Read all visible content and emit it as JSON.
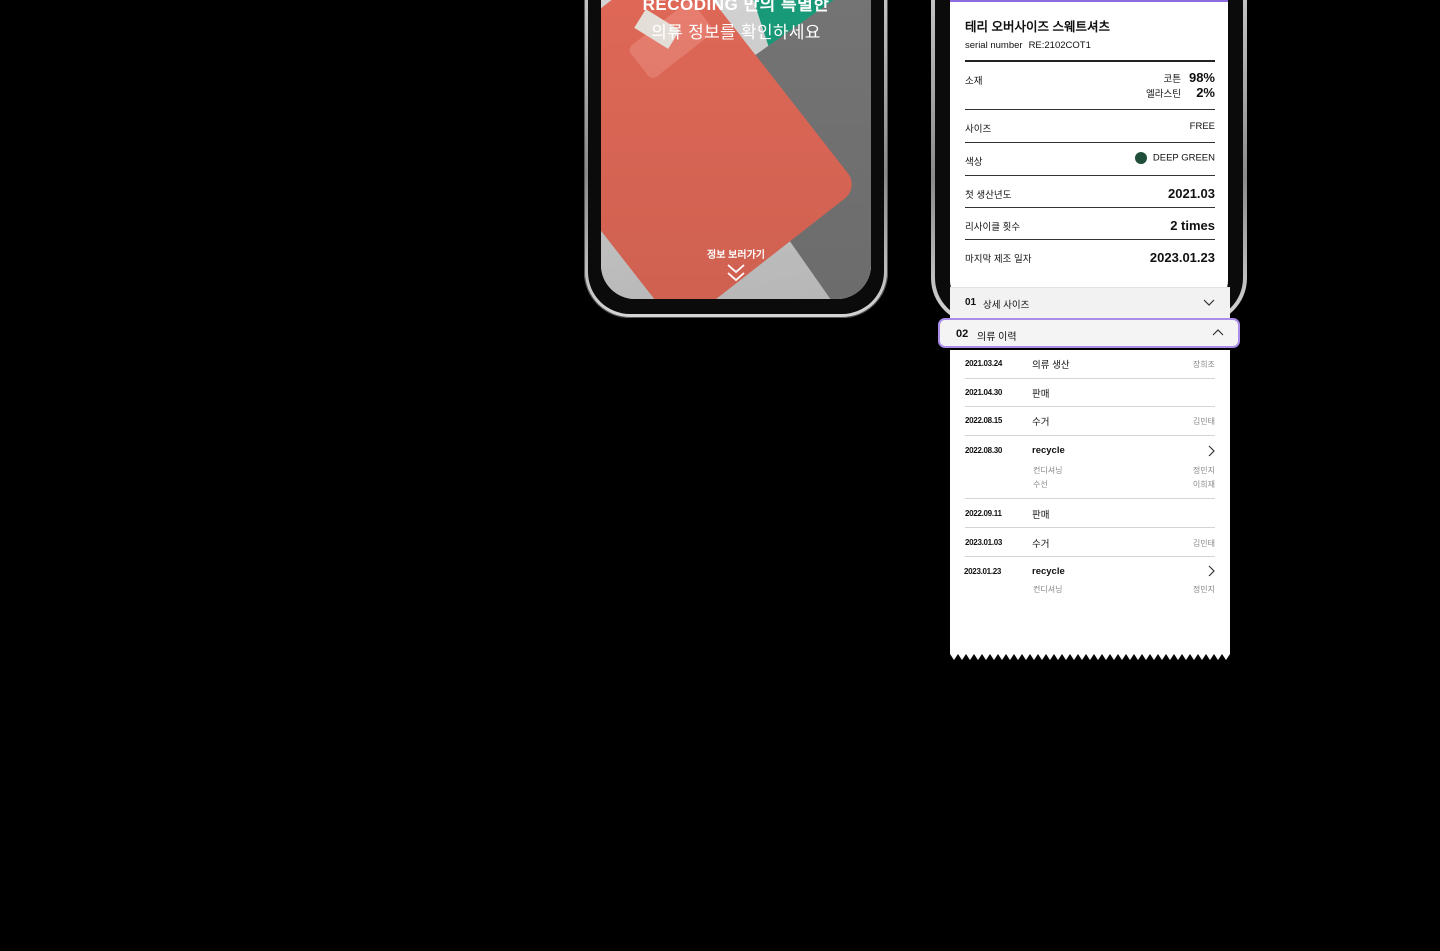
{
  "left_phone": {
    "hero_line1": "RECODING 만의 특별한",
    "hero_line2": "의류 정보를 확인하세요",
    "cta_label": "정보 보러가기"
  },
  "product": {
    "name": "테리 오버사이즈 스웨트셔츠",
    "serial_label": "serial number",
    "serial_value": "RE:2102COT1",
    "material_label": "소재",
    "materials": [
      {
        "name": "코튼",
        "pct": "98%"
      },
      {
        "name": "엘라스틴",
        "pct": "2%"
      }
    ],
    "size_label": "사이즈",
    "size_value": "FREE",
    "color_label": "색상",
    "color_value": "DEEP GREEN",
    "color_hex": "#1f4e3a",
    "first_year_label": "첫 생산년도",
    "first_year_value": "2021.03",
    "recycle_count_label": "리사이클 횟수",
    "recycle_count_value": "2 times",
    "last_made_label": "마지막 제조 일자",
    "last_made_value": "2023.01.23"
  },
  "accordion": [
    {
      "num": "01",
      "label": "상세 사이즈",
      "state": "collapsed"
    },
    {
      "num": "02",
      "label": "의류 이력",
      "state": "expanded"
    }
  ],
  "history": [
    {
      "date": "2021.03.24",
      "event": "의류 생산",
      "person": "장희조"
    },
    {
      "date": "2021.04.30",
      "event": "판매",
      "person": ""
    },
    {
      "date": "2022.08.15",
      "event": "수거",
      "person": "김민태"
    },
    {
      "date": "2022.08.30",
      "event": "recycle",
      "person": "",
      "subs": [
        {
          "label": "컨디셔닝",
          "person": "정민지"
        },
        {
          "label": "수선",
          "person": "이희재"
        }
      ]
    },
    {
      "date": "2022.09.11",
      "event": "판매",
      "person": ""
    },
    {
      "date": "2023.01.03",
      "event": "수거",
      "person": "김민태"
    },
    {
      "date": "2023.01.23",
      "event": "recycle",
      "person": "",
      "subs": [
        {
          "label": "컨디셔닝",
          "person": "정민지"
        }
      ]
    }
  ],
  "colors": {
    "accent": "#a98ee9",
    "background": "#000000"
  }
}
